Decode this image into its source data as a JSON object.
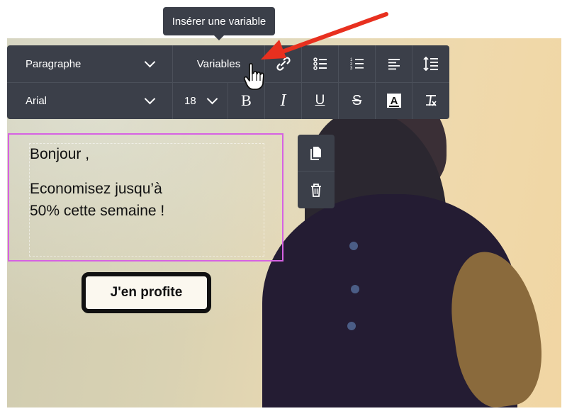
{
  "tooltip": {
    "text": "Insérer une variable"
  },
  "toolbar": {
    "block_format": {
      "value": "Paragraphe"
    },
    "variables_label": "Variables",
    "font_family": {
      "value": "Arial"
    },
    "font_size": {
      "value": "18"
    },
    "icons": {
      "unlink": "unlink-icon",
      "bulleted_list": "bulleted-list-icon",
      "numbered_list": "numbered-list-icon",
      "align": "align-left-icon",
      "line_height": "line-height-icon",
      "bold": "bold-icon",
      "italic": "italic-icon",
      "underline": "underline-icon",
      "strikethrough": "strikethrough-icon",
      "text_color": "text-color-icon",
      "clear_format": "clear-format-icon"
    }
  },
  "content": {
    "greeting": "Bonjour ,",
    "offer_line1": "Economisez jusqu’à",
    "offer_line2": "50% cette semaine !",
    "cta_label": "J'en profite"
  },
  "side_actions": {
    "copy": "copy-icon",
    "delete": "trash-icon"
  },
  "colors": {
    "toolbar_bg": "#3b3f49",
    "selection_border": "#d662e3",
    "arrow": "#e8301f"
  }
}
